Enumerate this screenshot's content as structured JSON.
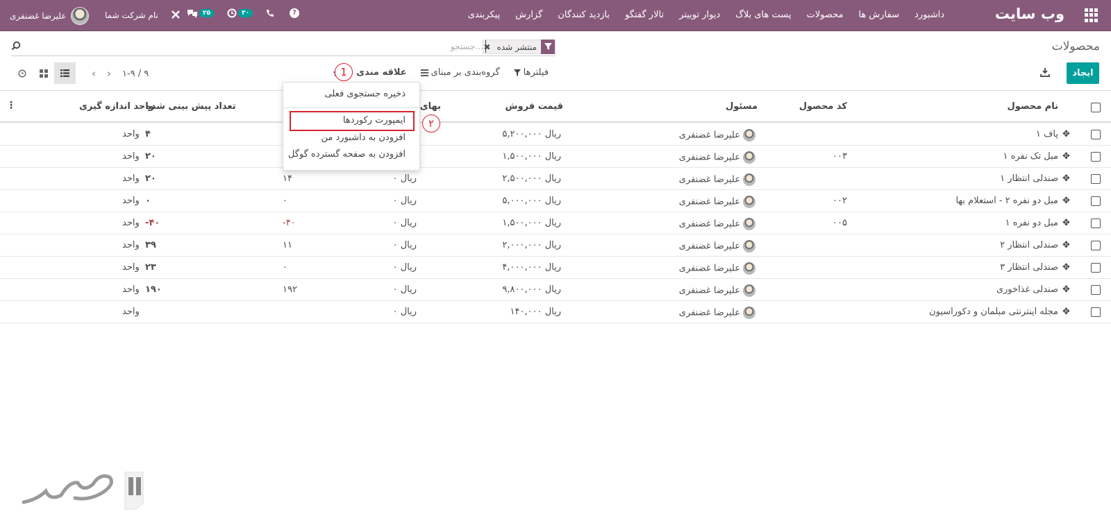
{
  "topbar": {
    "brand": "وب سایت",
    "menu": [
      "داشبورد",
      "سفارش ها",
      "محصولات",
      "پست های بلاگ",
      "دیوار توییتر",
      "تالار گفتگو",
      "بازدید کنندگان",
      "گزارش",
      "پیکربندی"
    ],
    "user_name": "علیرضا غضنفری",
    "company": "نام شرکت شما",
    "messages_count": "۲۵",
    "activities_count": "۳۰"
  },
  "control_panel": {
    "title": "محصولات",
    "facet_label": "منتشر شده",
    "search_placeholder": "جستجو...",
    "create_label": "ایجاد",
    "filters_label": "فیلترها",
    "groupby_label": "گروه‌بندی بر مبنای",
    "favorites_label": "علاقه مندی ها",
    "pager": "۱-۹ / ۹"
  },
  "markers": {
    "one": "1",
    "two": "۲"
  },
  "favorites_menu": {
    "save_search": "ذخیره جستجوی فعلی",
    "import_records": "ایمپورت رکوردها",
    "add_dashboard": "افزودن به داشبورد من",
    "add_spreadsheet": "افزودن به صفحه گسترده گوگل"
  },
  "table": {
    "headers": {
      "name": "نام محصول",
      "code": "کد محصول",
      "responsible": "مسئول",
      "sale_price": "قیمت فروش",
      "cost": "بهای ت",
      "forecast": "تعداد پیش بینی شده",
      "uom": "واحد اندازه گیری"
    },
    "rows": [
      {
        "name": "پاف ۱",
        "code": "",
        "responsible": "علیرضا غضنفری",
        "price": "۵,۲۰۰,۰۰۰ ریال",
        "cost": "",
        "onhand": "",
        "forecast": "۴",
        "uom": "واحد",
        "neg": false
      },
      {
        "name": "مبل تک نفره ۱",
        "code": "۰۰۳",
        "responsible": "علیرضا غضنفری",
        "price": "۱,۵۰۰,۰۰۰ ریال",
        "cost": "",
        "onhand": "",
        "forecast": "۲۰",
        "uom": "واحد",
        "neg": false
      },
      {
        "name": "صندلی انتظار ۱",
        "code": "",
        "responsible": "علیرضا غضنفری",
        "price": "۲,۵۰۰,۰۰۰ ریال",
        "cost": "۰ ریال",
        "onhand": "۱۴",
        "forecast": "۲۰",
        "uom": "واحد",
        "neg": false
      },
      {
        "name": "مبل دو نفره ۲ - استعلام بها",
        "code": "۰۰۲",
        "responsible": "علیرضا غضنفری",
        "price": "۵,۰۰۰,۰۰۰ ریال",
        "cost": "۰ ریال",
        "onhand": "۰",
        "forecast": "۰",
        "uom": "واحد",
        "neg": false
      },
      {
        "name": "مبل دو نفره ۱",
        "code": "۰۰۵",
        "responsible": "علیرضا غضنفری",
        "price": "۱,۵۰۰,۰۰۰ ریال",
        "cost": "۰ ریال",
        "onhand": "-۴۰",
        "forecast": "-۴۰",
        "uom": "واحد",
        "neg": true
      },
      {
        "name": "صندلی انتظار ۲",
        "code": "",
        "responsible": "علیرضا غضنفری",
        "price": "۲,۰۰۰,۰۰۰ ریال",
        "cost": "۰ ریال",
        "onhand": "۱۱",
        "forecast": "۳۹",
        "uom": "واحد",
        "neg": false
      },
      {
        "name": "صندلی انتظار ۳",
        "code": "",
        "responsible": "علیرضا غضنفری",
        "price": "۴,۰۰۰,۰۰۰ ریال",
        "cost": "۰ ریال",
        "onhand": "۰",
        "forecast": "۲۳",
        "uom": "واحد",
        "neg": false
      },
      {
        "name": "صندلی غذاخوری",
        "code": "",
        "responsible": "علیرضا غضنفری",
        "price": "۹,۸۰۰,۰۰۰ ریال",
        "cost": "۰ ریال",
        "onhand": "۱۹۲",
        "forecast": "۱۹۰",
        "uom": "واحد",
        "neg": false
      },
      {
        "name": "مجله اینترنتی مبلمان و دکوراسیون",
        "code": "",
        "responsible": "علیرضا غضنفری",
        "price": "۱۴۰,۰۰۰ ریال",
        "cost": "۰ ریال",
        "onhand": "",
        "forecast": "",
        "uom": "واحد",
        "neg": false
      }
    ]
  },
  "colors": {
    "primary": "#875a7b",
    "accent": "#00a09d",
    "highlight": "#d9232d"
  }
}
